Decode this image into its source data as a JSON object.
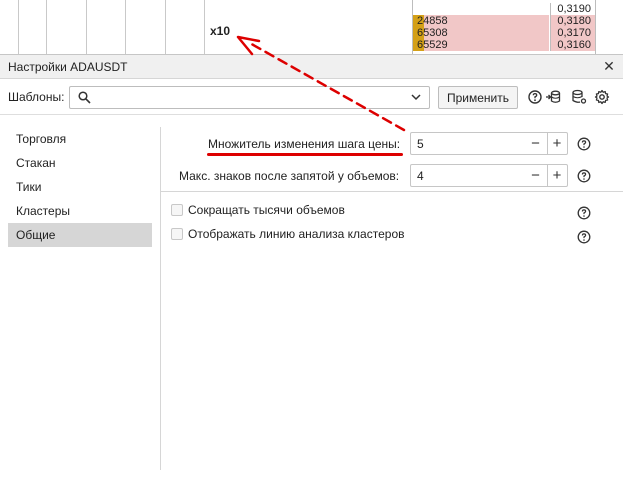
{
  "background": {
    "multiplier_label": "x10",
    "order_book": [
      {
        "volume": "",
        "price": "0,3190",
        "side": "bid"
      },
      {
        "volume": "24858",
        "price": "0,3180",
        "side": "ask"
      },
      {
        "volume": "65308",
        "price": "0,3170",
        "side": "ask"
      },
      {
        "volume": "65529",
        "price": "0,3160",
        "side": "ask"
      }
    ]
  },
  "dialog": {
    "title": "Настройки ADAUSDT",
    "templates": {
      "label": "Шаблоны:",
      "placeholder": "",
      "apply_label": "Применить",
      "icons": [
        "help-icon",
        "database-arrow-icon",
        "database-settings-icon",
        "gear-icon"
      ]
    },
    "sidebar": {
      "items": [
        {
          "label": "Торговля",
          "active": false
        },
        {
          "label": "Стакан",
          "active": false
        },
        {
          "label": "Тики",
          "active": false
        },
        {
          "label": "Кластеры",
          "active": false
        },
        {
          "label": "Общие",
          "active": true
        }
      ]
    },
    "settings": {
      "price_step_multiplier": {
        "label": "Множитель изменения шага цены:",
        "value": "5"
      },
      "volume_decimals": {
        "label": "Макс. знаков после запятой у объемов:",
        "value": "4"
      },
      "shorten_thousands": {
        "label": "Сокращать тысячи объемов",
        "checked": false
      },
      "show_cluster_line": {
        "label": "Отображать линию анализа кластеров",
        "checked": false
      }
    },
    "annotation_color": "#dd0000"
  }
}
